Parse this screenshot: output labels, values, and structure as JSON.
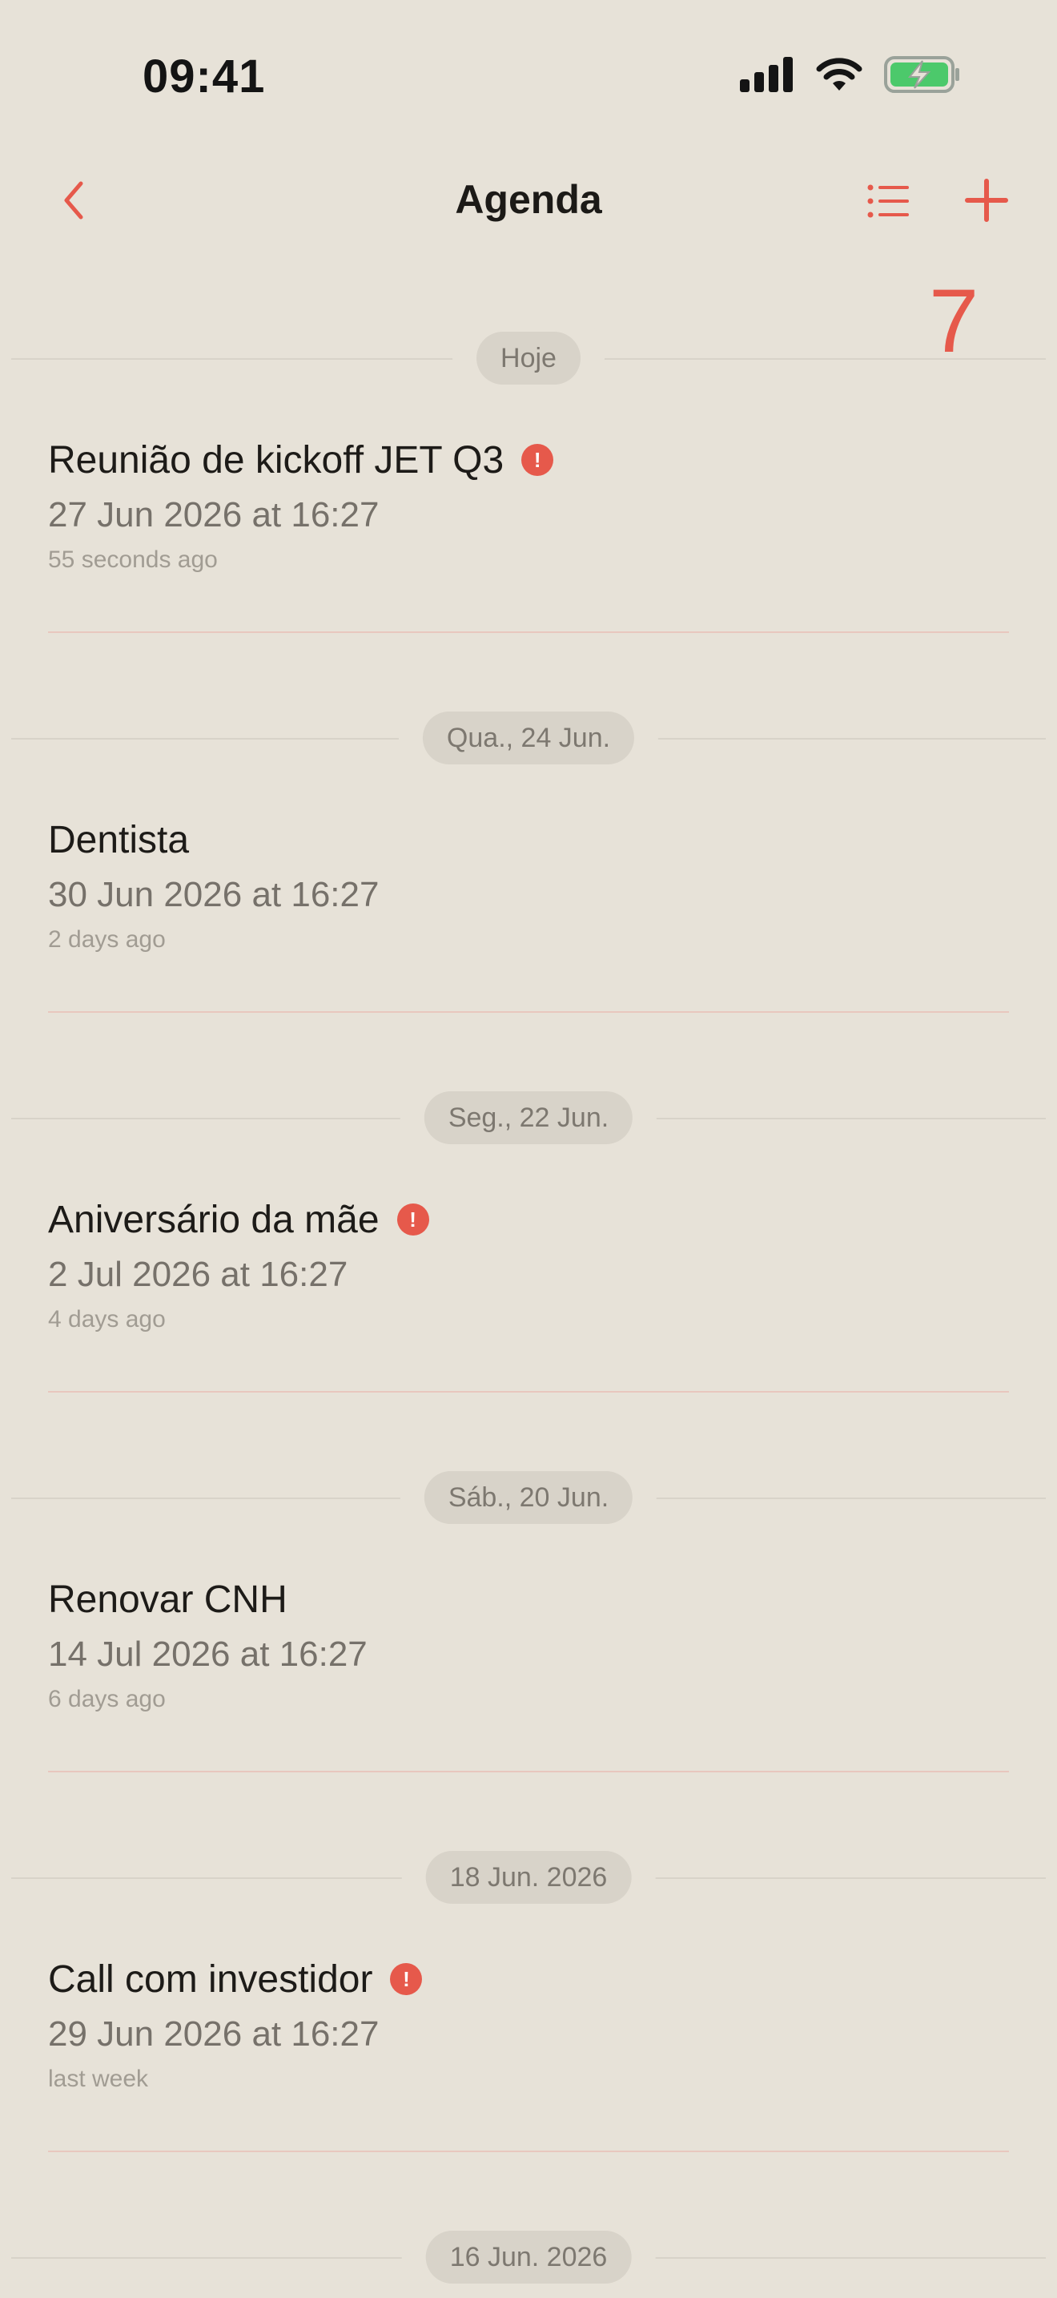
{
  "status_bar": {
    "time": "09:41"
  },
  "nav": {
    "title": "Agenda"
  },
  "badge": {
    "count": "7"
  },
  "colors": {
    "accent": "#e6594b",
    "background": "#e7e2d8",
    "pill": "#d8d3c9",
    "battery": "#4cc96b"
  },
  "icons": {
    "back": "chevron-left-icon",
    "list": "list-icon",
    "add": "plus-icon",
    "alert": "exclamation-circle-icon"
  },
  "sections": [
    {
      "label": "Hoje",
      "event": {
        "title": "Reunião de kickoff JET Q3",
        "date": "27 Jun 2026 at 16:27",
        "relative": "55 seconds ago",
        "important": true
      }
    },
    {
      "label": "Qua., 24 Jun.",
      "event": {
        "title": "Dentista",
        "date": "30 Jun 2026 at 16:27",
        "relative": "2 days ago",
        "important": false
      }
    },
    {
      "label": "Seg., 22 Jun.",
      "event": {
        "title": "Aniversário da mãe",
        "date": "2 Jul 2026 at 16:27",
        "relative": "4 days ago",
        "important": true
      }
    },
    {
      "label": "Sáb., 20 Jun.",
      "event": {
        "title": "Renovar CNH",
        "date": "14 Jul 2026 at 16:27",
        "relative": "6 days ago",
        "important": false
      }
    },
    {
      "label": "18 Jun. 2026",
      "event": {
        "title": "Call com investidor",
        "date": "29 Jun 2026 at 16:27",
        "relative": "last week",
        "important": true
      }
    },
    {
      "label": "16 Jun. 2026"
    }
  ]
}
